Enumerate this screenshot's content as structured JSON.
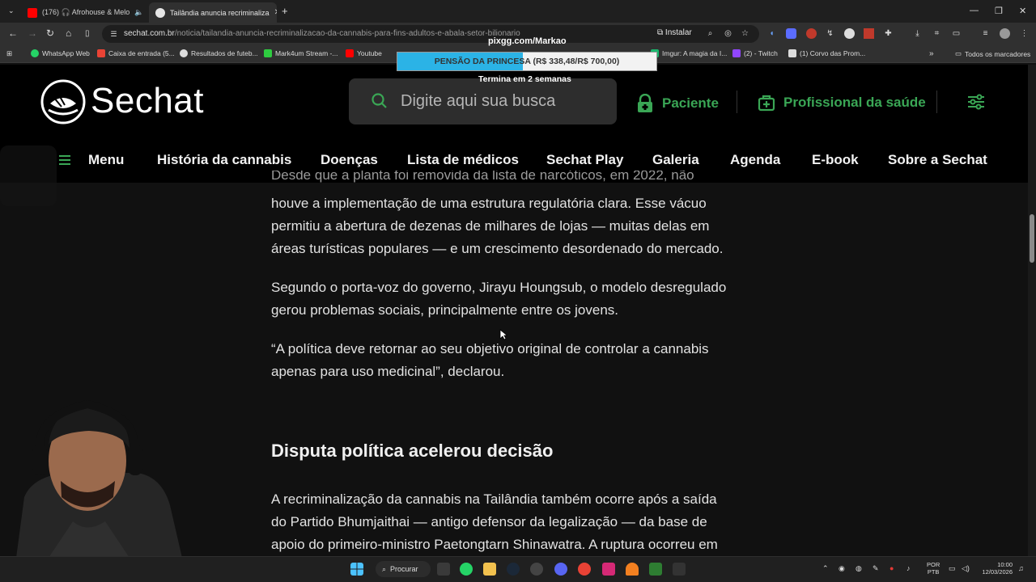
{
  "browser": {
    "tabs": [
      {
        "label": "(176) 🎧 Afrohouse & Melo",
        "icon": "youtube-icon",
        "active": false
      },
      {
        "label": "Tailândia anuncia recriminaliza",
        "icon": "sechat-favicon",
        "active": true
      }
    ],
    "new_tab": "+",
    "url_domain": "sechat.com.br",
    "url_path": "/noticia/tailandia-anuncia-recriminalizacao-da-cannabis-para-fins-adultos-e-abala-setor-bilionario",
    "install_label": "Instalar",
    "bookmarks": [
      {
        "label": "WhatsApp Web",
        "color": "#25d366"
      },
      {
        "label": "Caixa de entrada (5...",
        "color": "#ea4335"
      },
      {
        "label": "Resultados de futeb...",
        "color": "#dddddd"
      },
      {
        "label": "Mark4um Stream -...",
        "color": "#2ecc40"
      },
      {
        "label": "Youtube",
        "color": "#ff0000"
      },
      {
        "label": "Imgur: A magia da I...",
        "color": "#1bb76e"
      },
      {
        "label": "(2) - Twitch",
        "color": "#9146ff"
      },
      {
        "label": "(1) Corvo das Prom...",
        "color": "#dddddd"
      }
    ],
    "bookmarks_more": "»",
    "all_bookmarks": "Todos os marcadores"
  },
  "overlay": {
    "title": "pixgg.com/Markao",
    "goal_text": "PENSÃO DA PRINCESA (R$ 338,48/R$ 700,00)",
    "goal_fraction": 0.4835,
    "goal_color": "#2bb3e6",
    "subtitle": "Termina em 2 semanas"
  },
  "site": {
    "logo_text": "Sechat",
    "search_placeholder": "Digite aqui sua busca",
    "header_links": {
      "patient": "Paciente",
      "professional": "Profissional da saúde"
    },
    "accent": "#3aa655",
    "nav": {
      "menu": "Menu",
      "items": [
        "História da cannabis",
        "Doenças",
        "Lista de médicos",
        "Sechat Play",
        "Galeria",
        "Agenda",
        "E-book",
        "Sobre a Sechat"
      ]
    }
  },
  "article": {
    "p0_partial": "Desde que a planta foi removida da lista de narcóticos, em 2022, não",
    "p1_lines": [
      "houve a implementação de uma estrutura regulatória clara. Esse vácuo",
      "permitiu a abertura de dezenas de milhares de lojas — muitas delas em",
      "áreas turísticas populares — e um crescimento desordenado do mercado."
    ],
    "p2_lines": [
      "Segundo o porta-voz do governo, Jirayu Houngsub, o modelo desregulado",
      "gerou problemas sociais, principalmente entre os jovens."
    ],
    "p3_lines": [
      "“A política deve retornar ao seu objetivo original de controlar a cannabis",
      "apenas para uso medicinal”, declarou."
    ],
    "heading": "Disputa política acelerou decisão",
    "p4_lines": [
      "A recriminalização da cannabis na Tailândia também ocorre após a saída",
      "do Partido Bhumjaithai — antigo defensor da legalização — da base de",
      "apoio do primeiro-ministro Paetongtarn Shinawatra. A ruptura ocorreu em"
    ]
  },
  "taskbar": {
    "search_label": "Procurar",
    "lang_line1": "POR",
    "lang_line2": "PTB",
    "time": "10:00",
    "date": "12/03/2026"
  }
}
